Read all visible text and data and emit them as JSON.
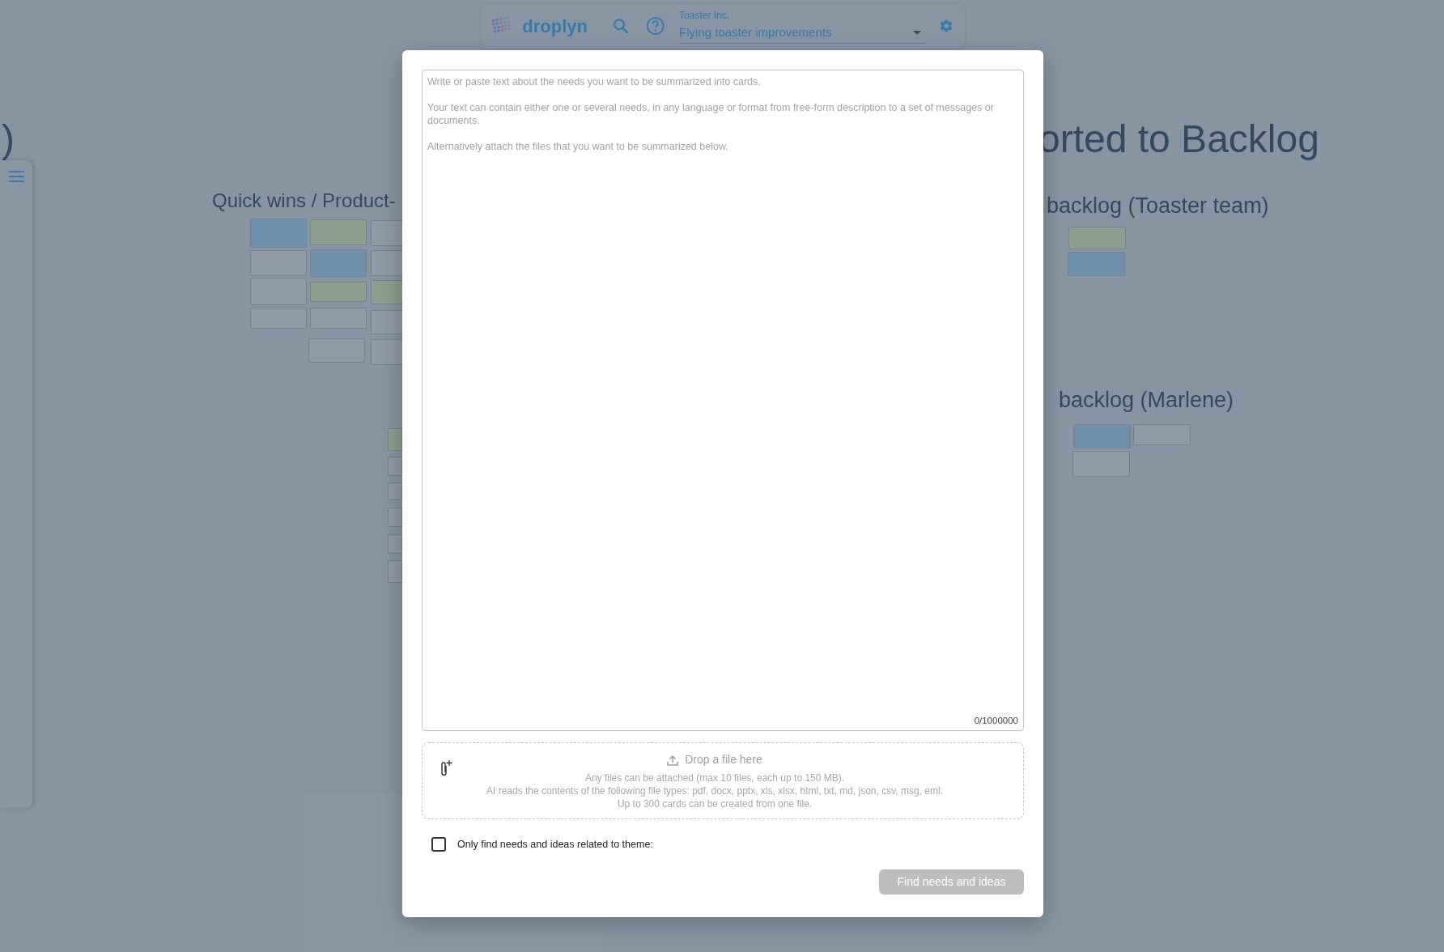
{
  "board": {
    "headings": [
      {
        "text": ")",
        "kind": "title"
      },
      {
        "text": "orted to Backlog",
        "kind": "title"
      },
      {
        "text": "Quick wins / Product-",
        "kind": "section"
      },
      {
        "text": "backlog (Toaster team)",
        "kind": "section"
      },
      {
        "text": "backlog (Marlene)",
        "kind": "section"
      }
    ]
  },
  "topbar": {
    "logo_text": "droplyn",
    "org": "Toaster Inc.",
    "project": "Flying toaster improvements"
  },
  "modal": {
    "textarea": {
      "placeholder": "Write or paste text about the needs you want to be summarized into cards.\n\nYour text can contain either one or several needs, in any language or format from free-form description to a set of messages or documents.\n\nAlternatively attach the files that you want to be summarized below.",
      "counter": "0/1000000"
    },
    "dropzone": {
      "title": "Drop a file here",
      "lines": [
        "Any files can be attached (max 10 files, each up to 150 MB).",
        "AI reads the contents of the following file types: pdf, docx, pptx, xls, xlsx, html, txt, md, json, csv, msg, eml.",
        "Up to 300 cards can be created from one file."
      ]
    },
    "theme_filter": {
      "label": "Only find needs and ideas related to theme:",
      "checked": false
    },
    "submit": {
      "label": "Find needs and ideas",
      "disabled": true
    }
  }
}
